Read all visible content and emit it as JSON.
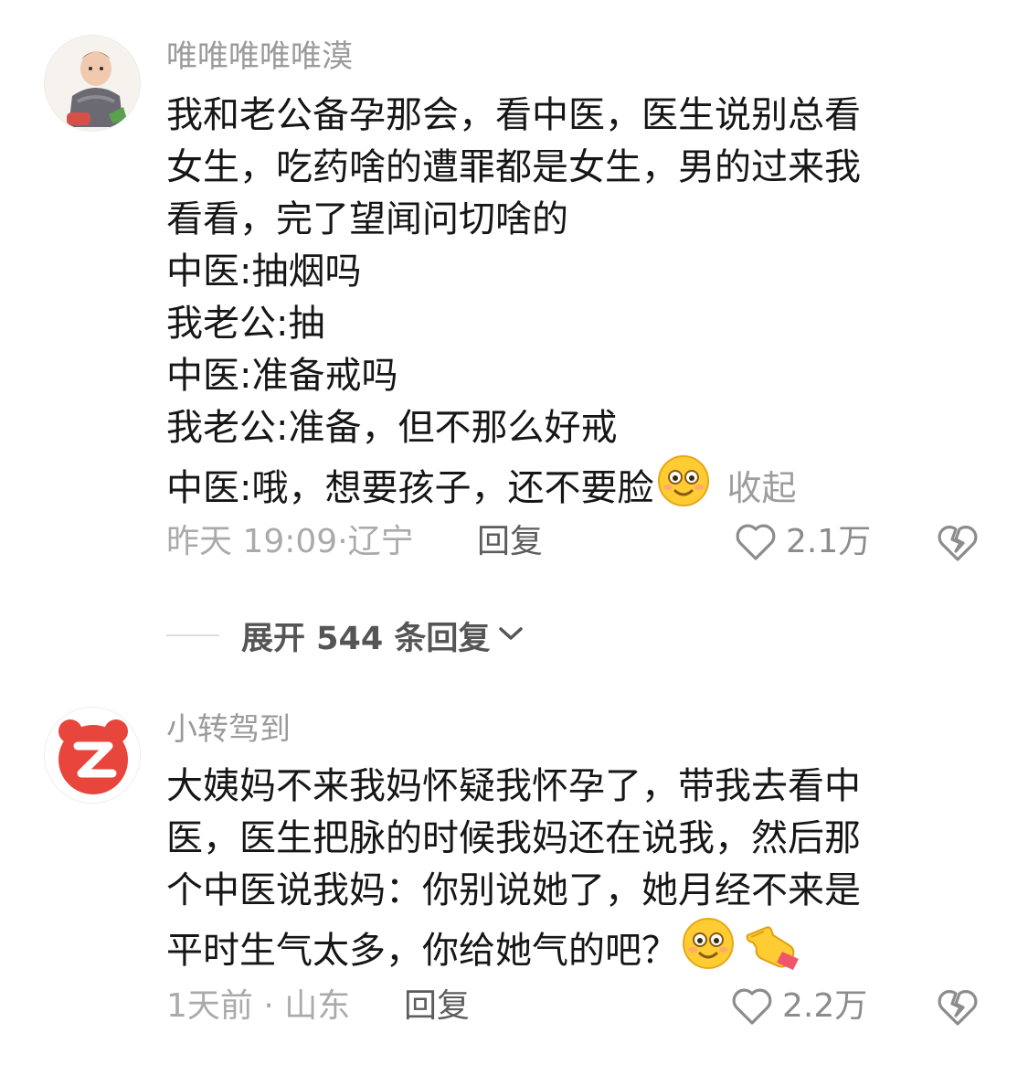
{
  "comments": [
    {
      "username": "唯唯唯唯唯漠",
      "avatar_icon": "baby-photo-avatar",
      "lines": [
        "我和老公备孕那会，看中医，医生说别总看",
        "女生，吃药啥的遭罪都是女生，男的过来我",
        "看看，完了望闻问切啥的",
        "中医:抽烟吗",
        "我老公:抽",
        "中医:准备戒吗",
        "我老公:准备，但不那么好戒",
        "中医:哦，想要孩子，还不要脸"
      ],
      "collapse_label": "收起",
      "time": "昨天 19:09",
      "location": "辽宁",
      "reply_label": "回复",
      "like_count": "2.1万"
    },
    {
      "username": "小转驾到",
      "avatar_icon": "zhuanzhuan-logo-avatar",
      "lines": [
        "大姨妈不来我妈怀疑我怀孕了，带我去看中",
        "医，医生把脉的时候我妈还在说我，然后那",
        "个中医说我妈：你别说她了，她月经不来是",
        "平时生气太多，你给她气的吧？"
      ],
      "time": "1天前",
      "location": "山东",
      "reply_label": "回复",
      "like_count": "2.2万"
    }
  ],
  "expand": {
    "label": "展开 544 条回复"
  },
  "colors": {
    "username": "#9b9b9b",
    "meta": "#aaaaaa",
    "reply": "#5d5d5d",
    "brand_red": "#e8453c",
    "emoji_yellow": "#ffcc33"
  }
}
